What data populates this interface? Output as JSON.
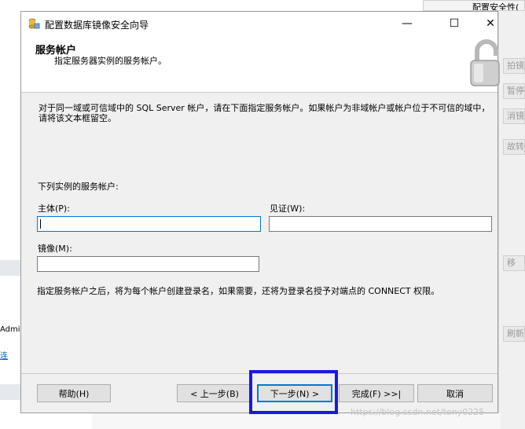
{
  "window": {
    "title": "配置数据库镜像安全向导",
    "minimize": "—",
    "maximize": "☐",
    "close": "✕"
  },
  "header": {
    "title": "服务帐户",
    "subtitle": "指定服务器实例的服务帐户。"
  },
  "content": {
    "description": "对于同一域或可信域中的 SQL Server 帐户，请在下面指定服务帐户。如果帐户为非域帐户或帐户位于不可信的域中，请将该文本框留空。",
    "section_label": "下列实例的服务帐户:",
    "principal_label": "主体(P):",
    "principal_value": "",
    "witness_label": "见证(W):",
    "witness_value": "",
    "mirror_label": "镜像(M):",
    "mirror_value": "",
    "note": "指定服务帐户之后，将为每个帐户创建登录名，如果需要，还将为登录名授予对端点的 CONNECT 权限。"
  },
  "buttons": {
    "help": "帮助(H)",
    "back": "< 上一步(B)",
    "next": "下一步(N) >",
    "finish": "完成(F) >>|",
    "cancel": "取消"
  },
  "background": {
    "top_right": "配置安全性(",
    "right_items": [
      "拍镜",
      "暂停",
      "消镜",
      "故转"
    ],
    "right_lower_1": "移",
    "right_lower_2": "刷新",
    "left_text": "Admi",
    "left_link": "连"
  },
  "watermark": "https://blog.csdn.net/tony0225"
}
